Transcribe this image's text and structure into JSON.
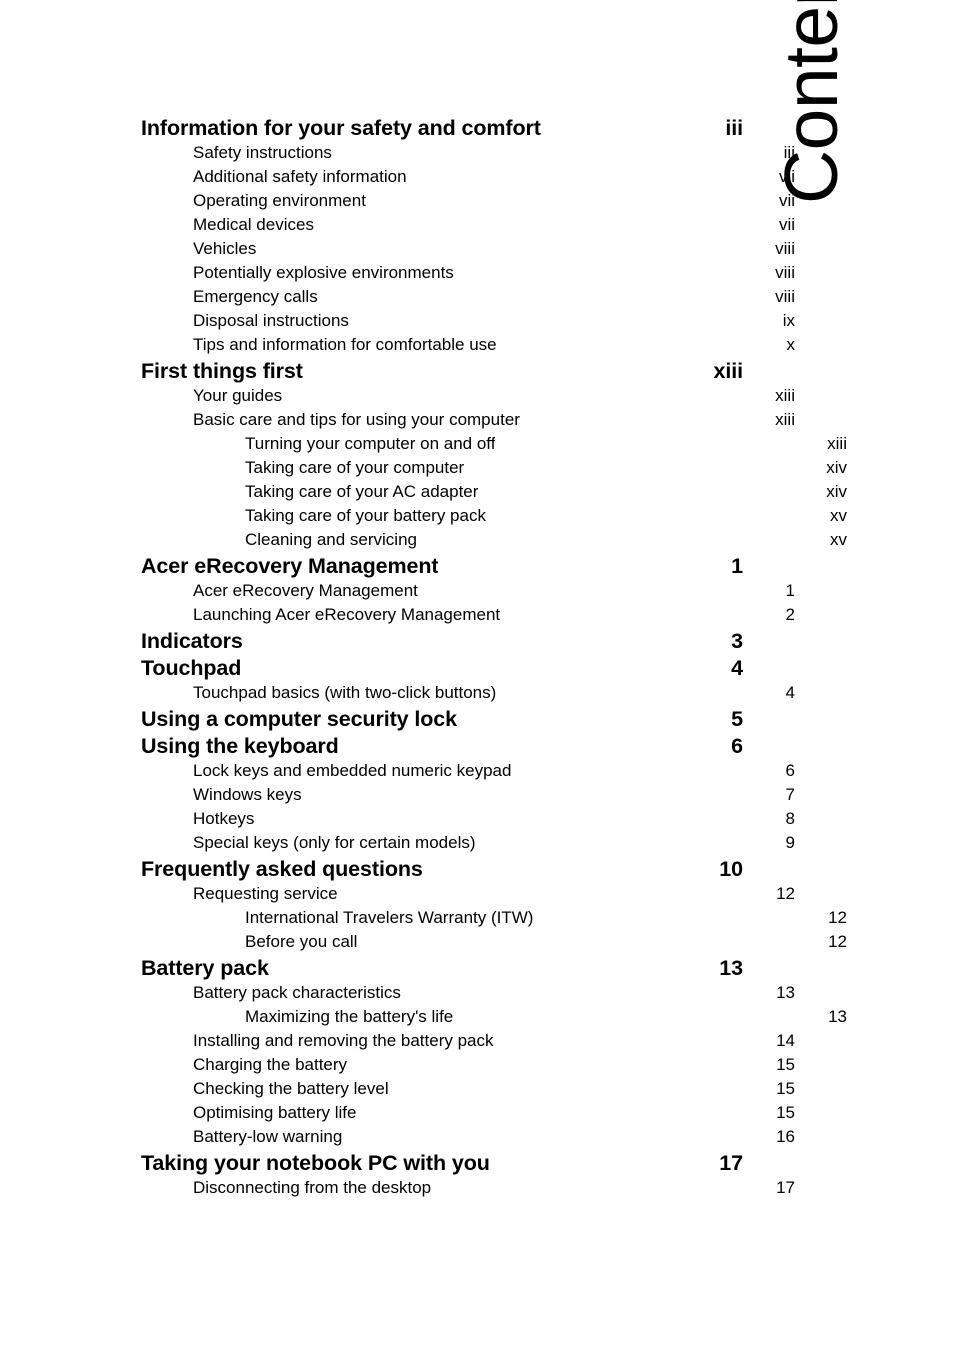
{
  "page": {
    "title": "Contents"
  },
  "toc": {
    "entries": [
      {
        "level": 1,
        "label": "Information for your safety and comfort",
        "page": "iii"
      },
      {
        "level": 2,
        "label": "Safety instructions",
        "page": "iii"
      },
      {
        "level": 2,
        "label": "Additional safety information",
        "page": "vii"
      },
      {
        "level": 2,
        "label": "Operating environment",
        "page": "vii"
      },
      {
        "level": 2,
        "label": "Medical devices",
        "page": "vii"
      },
      {
        "level": 2,
        "label": "Vehicles",
        "page": "viii"
      },
      {
        "level": 2,
        "label": "Potentially explosive environments",
        "page": "viii"
      },
      {
        "level": 2,
        "label": "Emergency calls",
        "page": "viii"
      },
      {
        "level": 2,
        "label": "Disposal instructions",
        "page": "ix"
      },
      {
        "level": 2,
        "label": "Tips and information for comfortable use",
        "page": "x"
      },
      {
        "level": 1,
        "label": "First things first",
        "page": "xiii"
      },
      {
        "level": 2,
        "label": "Your guides",
        "page": "xiii"
      },
      {
        "level": 2,
        "label": "Basic care and tips for using your computer",
        "page": "xiii"
      },
      {
        "level": 3,
        "label": "Turning your computer on and off",
        "page": "xiii"
      },
      {
        "level": 3,
        "label": "Taking care of your computer",
        "page": "xiv"
      },
      {
        "level": 3,
        "label": "Taking care of your AC adapter",
        "page": "xiv"
      },
      {
        "level": 3,
        "label": "Taking care of your battery pack",
        "page": "xv"
      },
      {
        "level": 3,
        "label": "Cleaning and servicing",
        "page": "xv"
      },
      {
        "level": 1,
        "label": "Acer eRecovery Management",
        "page": "1"
      },
      {
        "level": 2,
        "label": "Acer eRecovery Management",
        "page": "1"
      },
      {
        "level": 2,
        "label": "Launching Acer eRecovery Management",
        "page": "2"
      },
      {
        "level": 1,
        "label": "Indicators",
        "page": "3"
      },
      {
        "level": 1,
        "label": "Touchpad",
        "page": "4"
      },
      {
        "level": 2,
        "label": "Touchpad basics (with two-click buttons)",
        "page": "4"
      },
      {
        "level": 1,
        "label": "Using a computer security lock",
        "page": "5"
      },
      {
        "level": 1,
        "label": "Using the keyboard",
        "page": "6"
      },
      {
        "level": 2,
        "label": "Lock keys and embedded numeric keypad",
        "page": "6"
      },
      {
        "level": 2,
        "label": "Windows keys",
        "page": "7"
      },
      {
        "level": 2,
        "label": "Hotkeys",
        "page": "8"
      },
      {
        "level": 2,
        "label": "Special keys (only for certain models)",
        "page": "9"
      },
      {
        "level": 1,
        "label": "Frequently asked questions",
        "page": "10"
      },
      {
        "level": 2,
        "label": "Requesting service",
        "page": "12"
      },
      {
        "level": 3,
        "label": "International Travelers Warranty (ITW)",
        "page": "12"
      },
      {
        "level": 3,
        "label": "Before you call",
        "page": "12"
      },
      {
        "level": 1,
        "label": "Battery pack",
        "page": "13"
      },
      {
        "level": 2,
        "label": "Battery pack characteristics",
        "page": "13"
      },
      {
        "level": 3,
        "label": "Maximizing the battery's life",
        "page": "13"
      },
      {
        "level": 2,
        "label": "Installing and removing the battery pack",
        "page": "14"
      },
      {
        "level": 2,
        "label": "Charging the battery",
        "page": "15"
      },
      {
        "level": 2,
        "label": "Checking the battery level",
        "page": "15"
      },
      {
        "level": 2,
        "label": "Optimising battery life",
        "page": "15"
      },
      {
        "level": 2,
        "label": "Battery-low warning",
        "page": "16"
      },
      {
        "level": 1,
        "label": "Taking your notebook PC with you",
        "page": "17"
      },
      {
        "level": 2,
        "label": "Disconnecting from the desktop",
        "page": "17"
      }
    ]
  }
}
